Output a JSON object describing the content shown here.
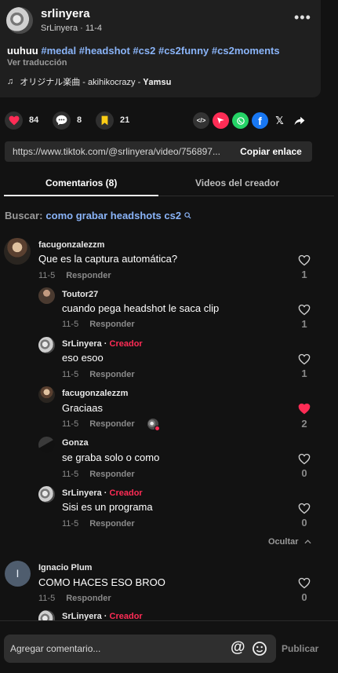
{
  "post": {
    "author_name": "srlinyera",
    "author_sub": "SrLinyera · 11-4",
    "caption_text": "uuhuu",
    "hashtags": [
      "#medal",
      "#headshot",
      "#cs2",
      "#cs2funny",
      "#cs2moments"
    ],
    "translate_label": "Ver traducción",
    "music_icon": "music-note-icon",
    "music": "オリジナル楽曲 - akihikocrazy - 𝐘𝐚𝐦𝐬𝐮"
  },
  "actions": {
    "likes": "84",
    "comments": "8",
    "saves": "21"
  },
  "share": {
    "icons": [
      "embed-icon",
      "send-icon",
      "whatsapp-icon",
      "facebook-icon",
      "x-icon",
      "share-arrow-icon"
    ]
  },
  "link": {
    "url": "https://www.tiktok.com/@srlinyera/video/756897...",
    "copy_label": "Copiar enlace"
  },
  "tabs": {
    "comments": "Comentarios (8)",
    "creator_videos": "Videos del creador"
  },
  "search": {
    "label": "Buscar:",
    "query": "como grabar headshots cs2"
  },
  "comments": [
    {
      "user": "facugonzalezzm",
      "creator": "",
      "text": "Que es la captura automática?",
      "date": "11-5",
      "reply": "Responder",
      "likes": "1",
      "liked": false
    },
    {
      "user": "Toutor27",
      "creator": "",
      "text": "cuando pega headshot le saca clip",
      "date": "11-5",
      "reply": "Responder",
      "likes": "1",
      "liked": false
    },
    {
      "user": "SrLinyera · ",
      "creator": "Creador",
      "text": "eso esoo",
      "date": "11-5",
      "reply": "Responder",
      "likes": "1",
      "liked": false
    },
    {
      "user": "facugonzalezzm",
      "creator": "",
      "text": "Graciaas",
      "date": "11-5",
      "reply": "Responder",
      "likes": "2",
      "liked": true
    },
    {
      "user": "Gonza",
      "creator": "",
      "text": "se graba solo o como",
      "date": "11-5",
      "reply": "Responder",
      "likes": "0",
      "liked": false
    },
    {
      "user": "SrLinyera · ",
      "creator": "Creador",
      "text": "Sisi es un programa",
      "date": "11-5",
      "reply": "Responder",
      "likes": "0",
      "liked": false
    },
    {
      "user": "Ignacio Plum",
      "creator": "",
      "text": "COMO HACES ESO BROO",
      "date": "11-5",
      "reply": "Responder",
      "likes": "0",
      "liked": false
    },
    {
      "user": "SrLinyera · ",
      "creator": "Creador",
      "text": "",
      "date": "",
      "reply": "",
      "likes": "",
      "liked": false
    }
  ],
  "ignacio_initial": "I",
  "hide_label": "Ocultar",
  "input": {
    "placeholder": "Agregar comentario...",
    "publish_label": "Publicar"
  },
  "colors": {
    "background": "#121212",
    "card": "#1f1f1f",
    "accent_red": "#fe2c55",
    "hashtag_blue": "#8ab4f8",
    "bookmark_yellow": "#facc15"
  }
}
